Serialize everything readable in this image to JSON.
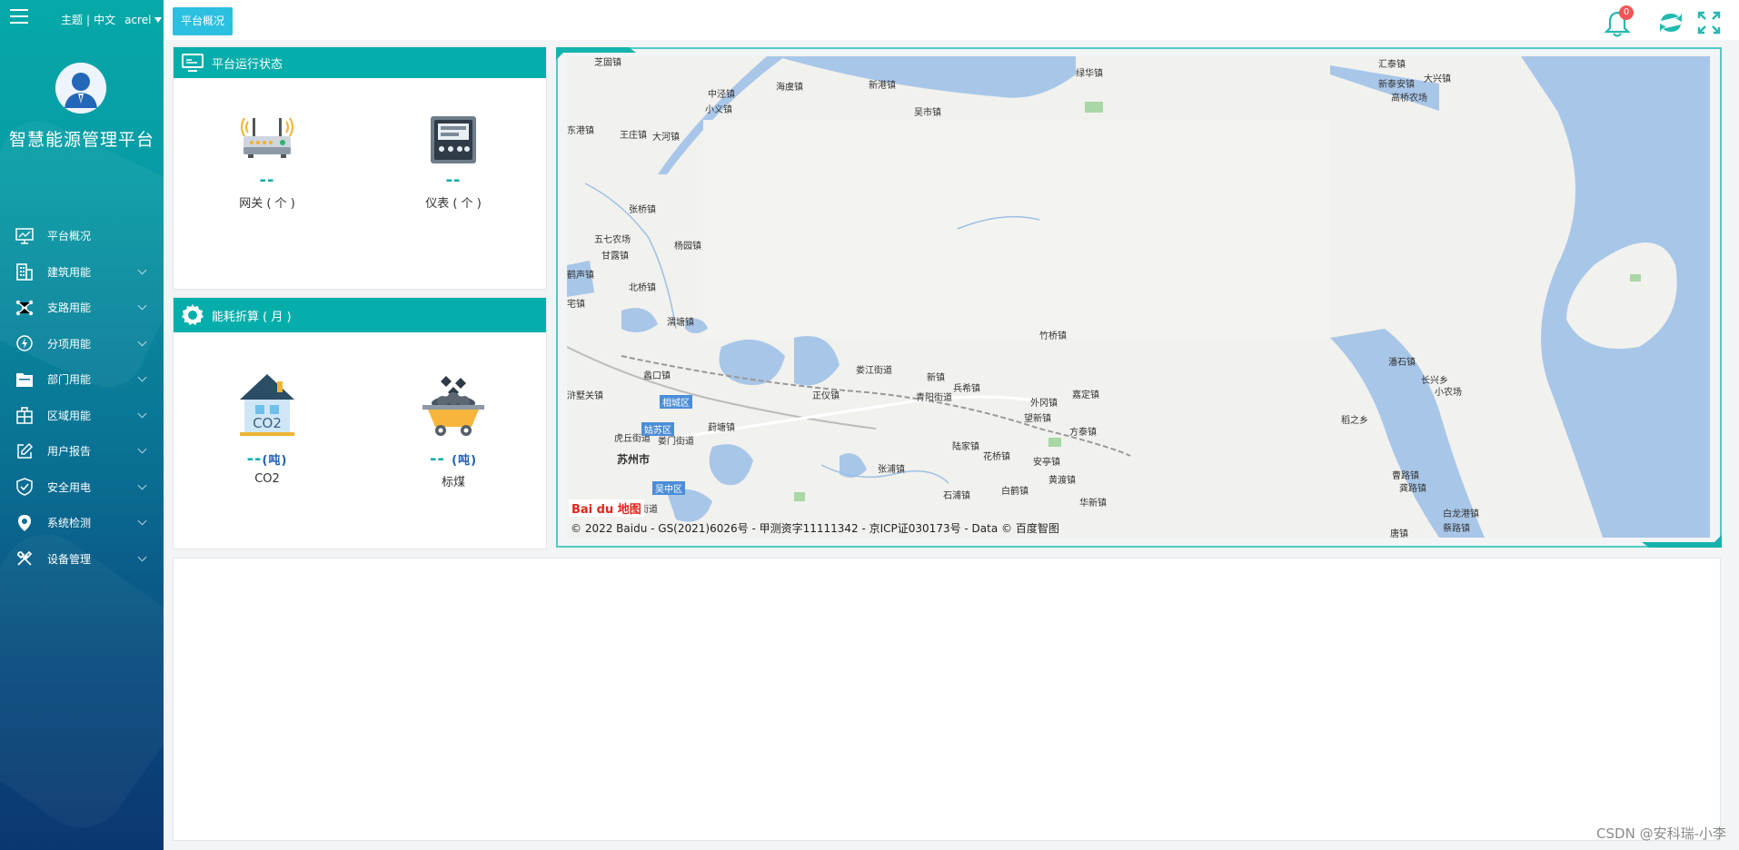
{
  "sidebar": {
    "top_links": {
      "theme": "主题",
      "separator": "|",
      "language": "中文",
      "user": "acrel"
    },
    "app_title": "智慧能源管理平台",
    "items": [
      {
        "label": "平台概况",
        "icon": "monitor-icon",
        "has_children": false
      },
      {
        "label": "建筑用能",
        "icon": "building-icon",
        "has_children": true
      },
      {
        "label": "支路用能",
        "icon": "network-icon",
        "has_children": true
      },
      {
        "label": "分项用能",
        "icon": "lightning-icon",
        "has_children": true
      },
      {
        "label": "部门用能",
        "icon": "folder-icon",
        "has_children": true
      },
      {
        "label": "区域用能",
        "icon": "grid-icon",
        "has_children": true
      },
      {
        "label": "用户报告",
        "icon": "edit-icon",
        "has_children": true
      },
      {
        "label": "安全用电",
        "icon": "shield-icon",
        "has_children": true
      },
      {
        "label": "系统检测",
        "icon": "location-icon",
        "has_children": true
      },
      {
        "label": "设备管理",
        "icon": "tools-icon",
        "has_children": true
      }
    ]
  },
  "header": {
    "breadcrumb_tag": "平台概况",
    "notification_count": "0"
  },
  "status_card": {
    "title": "平台运行状态",
    "gateway": {
      "value": "--",
      "label": "网关 ( 个 )"
    },
    "meter": {
      "value": "--",
      "label": "仪表 ( 个 )"
    }
  },
  "energy_card": {
    "title": "能耗折算 ( 月 )",
    "co2": {
      "value": "--",
      "unit": "(吨)",
      "label": "CO2",
      "icon_text": "CO2"
    },
    "coal": {
      "value": "-- ",
      "unit": "(吨)",
      "label": "标煤"
    }
  },
  "map": {
    "attribution": "© 2022 Baidu - GS(2021)6026号 - 甲测资字11111342 - 京ICP证030173号 - Data © 百度智图",
    "logo": "Bai du 地图",
    "places": [
      {
        "name": "芝固镇"
      },
      {
        "name": "中泾镇"
      },
      {
        "name": "海虞镇"
      },
      {
        "name": "新港镇"
      },
      {
        "name": "绿华镇"
      },
      {
        "name": "小义镇"
      },
      {
        "name": "吴市镇"
      },
      {
        "name": "王庄镇"
      },
      {
        "name": "大河镇"
      },
      {
        "name": "东港镇"
      },
      {
        "name": "张桥镇"
      },
      {
        "name": "五七农场"
      },
      {
        "name": "杨园镇"
      },
      {
        "name": "甘露镇"
      },
      {
        "name": "北桥镇"
      },
      {
        "name": "渭塘镇"
      },
      {
        "name": "竹桥镇"
      },
      {
        "name": "蠡口镇"
      },
      {
        "name": "娄江街道"
      },
      {
        "name": "新镇"
      },
      {
        "name": "浒墅关镇"
      },
      {
        "name": "正仪镇"
      },
      {
        "name": "青阳街道"
      },
      {
        "name": "兵希镇"
      },
      {
        "name": "外冈镇"
      },
      {
        "name": "嘉定镇"
      },
      {
        "name": "望新镇"
      },
      {
        "name": "方泰镇"
      },
      {
        "name": "苏州市"
      },
      {
        "name": "虎丘街道"
      },
      {
        "name": "娄门街道"
      },
      {
        "name": "葑塘镇"
      },
      {
        "name": "陆家镇"
      },
      {
        "name": "花桥镇"
      },
      {
        "name": "安亭镇"
      },
      {
        "name": "张浦镇"
      },
      {
        "name": "石浦镇"
      },
      {
        "name": "白鹤镇"
      },
      {
        "name": "黄渡镇"
      },
      {
        "name": "华新镇"
      },
      {
        "name": "城南街道"
      },
      {
        "name": "汇泰镇"
      },
      {
        "name": "大兴镇"
      },
      {
        "name": "新泰安镇"
      },
      {
        "name": "高桥农场"
      },
      {
        "name": "潘石镇"
      },
      {
        "name": "长兴乡"
      },
      {
        "name": "小农场"
      },
      {
        "name": "稻之乡"
      },
      {
        "name": "曹路镇"
      },
      {
        "name": "龚路镇"
      },
      {
        "name": "白龙港镇"
      },
      {
        "name": "蔡路镇"
      },
      {
        "name": "唐镇"
      },
      {
        "name": "宅镇"
      },
      {
        "name": "鹤声镇"
      }
    ],
    "districts": [
      "相城区",
      "姑苏区",
      "吴中区"
    ]
  },
  "watermark": "CSDN @安科瑞-小李",
  "colors": {
    "accent": "#06aeab",
    "tag": "#2bbfe0",
    "badge": "#f25757"
  }
}
